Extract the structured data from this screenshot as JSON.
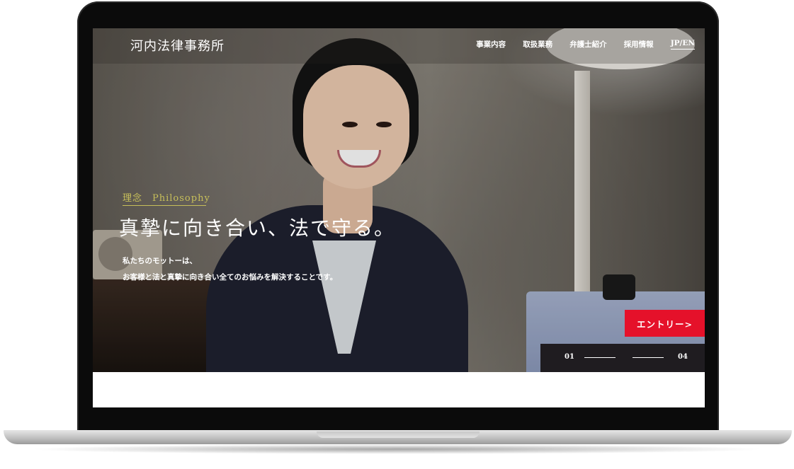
{
  "site": {
    "logo": "河内法律事務所"
  },
  "nav": {
    "items": [
      "事業内容",
      "取扱業務",
      "弁護士紹介",
      "採用情報"
    ],
    "lang": "JP/EN"
  },
  "hero": {
    "label": "理念　Philosophy",
    "headline": "真摯に向き合い、法で守る。",
    "body_line1": "私たちのモットーは、",
    "body_line2": "お客様と法と真摯に向き合い全てのお悩みを解決することです。",
    "entry_button": "エントリー>",
    "slider_start": "01",
    "slider_end": "04"
  }
}
